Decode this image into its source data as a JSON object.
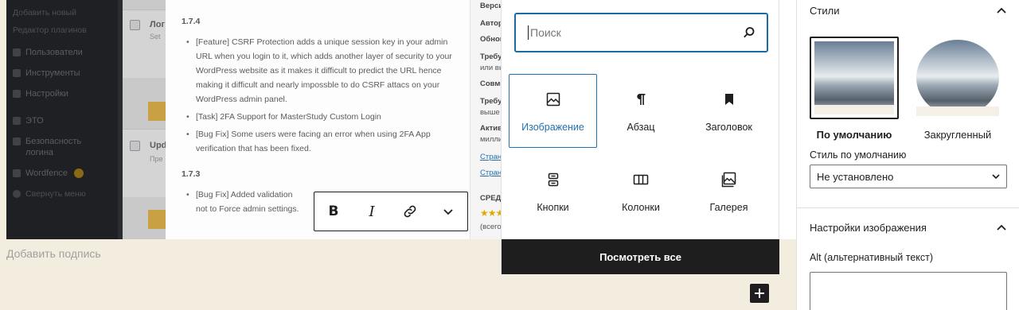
{
  "background_screenshot": {
    "wp_menu": [
      "Добавить новый",
      "Редактор плагинов",
      "Пользователи",
      "Инструменты",
      "Настройки",
      "ЭТО",
      "Безопасность",
      "логина",
      "Wordfence",
      "Свернуть меню"
    ],
    "plugin_names": [
      "Лог",
      "Upd"
    ],
    "plugin_subs": [
      "Set",
      "Пре"
    ],
    "changelog": {
      "version_1": "1.7.4",
      "items_1": [
        "[Feature] CSRF Protection adds a unique session key in your admin URL when you login to it, which adds another layer of security to your WordPress website as it makes it difficult to predict the URL hence making it difficult and nearly impossble to do CSRF attacs on your WordPress admin panel.",
        "[Task] 2FA Support for MasterStudy Custom Login",
        "[Bug Fix] Some users were facing an error when using 2FA App verification that has been fixed."
      ],
      "version_2": "1.7.3",
      "items_2": [
        "[Bug Fix] Added validation not to Force admin settings."
      ]
    },
    "meta": {
      "version": "Версия:",
      "author": "Автор:",
      "updated": "Обновл",
      "requires": "Требуем",
      "requires_sub": "или выш",
      "compat": "Совмес",
      "requires2": "Требуем",
      "requires2_sub": "выше",
      "active": "Активна",
      "active_sub": "миллион",
      "link1": "Страни",
      "link2": "Страни",
      "rating_label": "СРЕДНИ",
      "stars": "★★★",
      "rating_count": "(всего 9"
    }
  },
  "caption": {
    "placeholder": "Добавить подпись"
  },
  "format_toolbar": {
    "bold_label": "B",
    "italic_label": "I"
  },
  "inserter": {
    "search": {
      "placeholder": "Поиск",
      "value": ""
    },
    "blocks": [
      {
        "label": "Изображение",
        "icon": "image-icon",
        "active": true
      },
      {
        "label": "Абзац",
        "icon": "paragraph-icon",
        "active": false
      },
      {
        "label": "Заголовок",
        "icon": "bookmark-heading-icon",
        "active": false
      },
      {
        "label": "Кнопки",
        "icon": "buttons-icon",
        "active": false
      },
      {
        "label": "Колонки",
        "icon": "columns-icon",
        "active": false
      },
      {
        "label": "Галерея",
        "icon": "gallery-icon",
        "active": false
      }
    ],
    "view_all_label": "Посмотреть все"
  },
  "settings": {
    "styles_title": "Стили",
    "style_options": [
      {
        "label": "По умолчанию",
        "selected": true
      },
      {
        "label": "Закругленный",
        "selected": false
      }
    ],
    "default_style_label": "Стиль по умолчанию",
    "default_style_value": "Не установлено",
    "image_settings_title": "Настройки изображения",
    "alt_label": "Alt (альтернативный текст)"
  },
  "colors": {
    "accent": "#2271b1",
    "dark": "#1e1e1e",
    "canvas_bg": "#f3eddf"
  }
}
